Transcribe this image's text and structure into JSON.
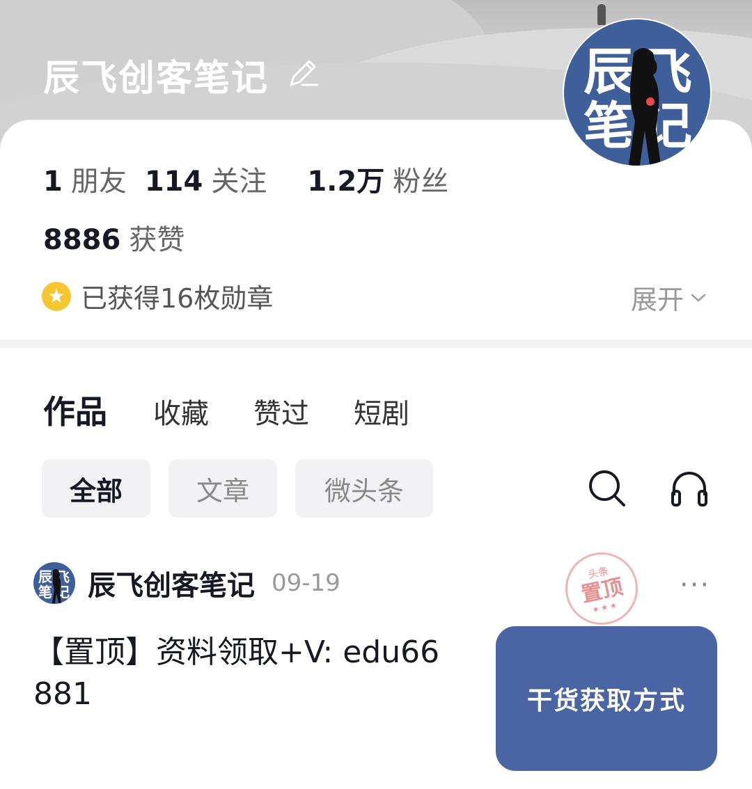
{
  "profile": {
    "name": "辰飞创客笔记",
    "avatar_text": [
      "辰",
      "飞",
      "笔",
      "记"
    ]
  },
  "stats": {
    "friends_count": "1",
    "friends_label": "朋友",
    "following_count": "114",
    "following_label": "关注",
    "followers_count": "1.2万",
    "followers_label": "粉丝",
    "likes_count": "8886",
    "likes_label": "获赞"
  },
  "badges": {
    "text": "已获得16枚勋章",
    "expand_label": "展开"
  },
  "tabs": [
    {
      "label": "作品",
      "active": true
    },
    {
      "label": "收藏",
      "active": false
    },
    {
      "label": "赞过",
      "active": false
    },
    {
      "label": "短剧",
      "active": false
    }
  ],
  "filters": [
    {
      "label": "全部",
      "active": true
    },
    {
      "label": "文章",
      "active": false
    },
    {
      "label": "微头条",
      "active": false
    }
  ],
  "icons": {
    "search": "search-icon",
    "listen": "headphones-icon",
    "edit": "pencil-icon",
    "more": "more-icon"
  },
  "post": {
    "author": "辰飞创客笔记",
    "date": "09-19",
    "stamp_top": "头条",
    "stamp_main": "置顶",
    "stamp_stars": "★★★",
    "text": "【置顶】资料领取+V: edu66881",
    "cover_text": "干货获取方式",
    "more_label": "···"
  },
  "colors": {
    "brand_blue": "#4a64a4",
    "avatar_blue": "#3f5f9a",
    "medal_gold": "#f7c530",
    "stamp_red": "#e98f8f"
  }
}
